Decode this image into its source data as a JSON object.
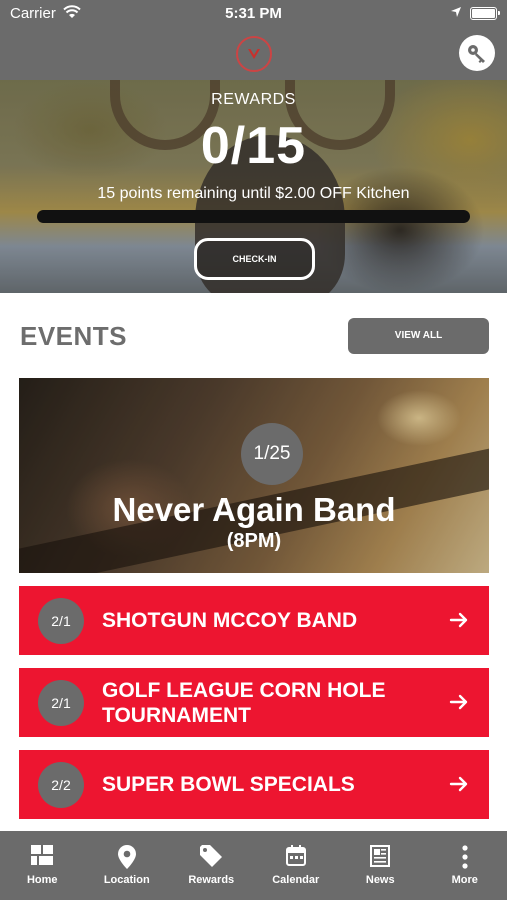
{
  "status_bar": {
    "carrier": "Carrier",
    "time": "5:31 PM"
  },
  "header": {
    "logo_icon": "club-logo-icon",
    "key_icon": "key-icon"
  },
  "rewards": {
    "label": "REWARDS",
    "count": "0/15",
    "remaining_text": "15 points remaining until $2.00 OFF Kitchen",
    "progress_fraction": 0,
    "checkin_label": "CHECK-IN"
  },
  "events": {
    "title": "EVENTS",
    "view_all_label": "VIEW ALL",
    "featured": {
      "date": "1/25",
      "title": "Never Again Band",
      "subtitle": "(8PM)"
    },
    "list": [
      {
        "date": "2/1",
        "name": "SHOTGUN MCCOY BAND"
      },
      {
        "date": "2/1",
        "name": "GOLF LEAGUE CORN HOLE TOURNAMENT"
      },
      {
        "date": "2/2",
        "name": "SUPER BOWL SPECIALS"
      }
    ]
  },
  "tabbar": {
    "items": [
      {
        "label": "Home",
        "icon": "home-grid-icon"
      },
      {
        "label": "Location",
        "icon": "map-pin-icon"
      },
      {
        "label": "Rewards",
        "icon": "tag-icon"
      },
      {
        "label": "Calendar",
        "icon": "calendar-icon"
      },
      {
        "label": "News",
        "icon": "newspaper-icon"
      },
      {
        "label": "More",
        "icon": "more-dots-icon"
      }
    ]
  },
  "colors": {
    "accent_red": "#ed1530",
    "bar_gray": "#6b6b6b",
    "title_gray": "#6d6d6d"
  }
}
